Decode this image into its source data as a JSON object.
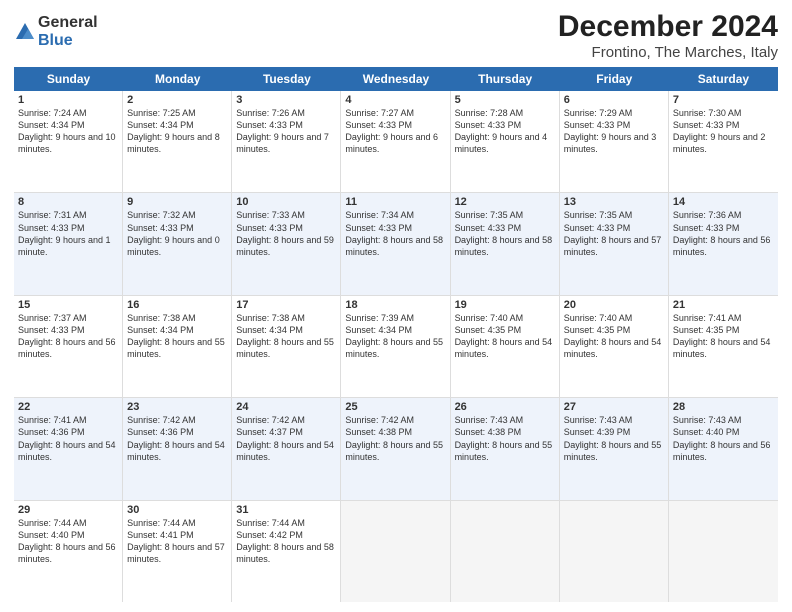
{
  "header": {
    "logo_general": "General",
    "logo_blue": "Blue",
    "title": "December 2024",
    "subtitle": "Frontino, The Marches, Italy"
  },
  "weekdays": [
    "Sunday",
    "Monday",
    "Tuesday",
    "Wednesday",
    "Thursday",
    "Friday",
    "Saturday"
  ],
  "weeks": [
    [
      {
        "day": "1",
        "sunrise": "Sunrise: 7:24 AM",
        "sunset": "Sunset: 4:34 PM",
        "daylight": "Daylight: 9 hours and 10 minutes."
      },
      {
        "day": "2",
        "sunrise": "Sunrise: 7:25 AM",
        "sunset": "Sunset: 4:34 PM",
        "daylight": "Daylight: 9 hours and 8 minutes."
      },
      {
        "day": "3",
        "sunrise": "Sunrise: 7:26 AM",
        "sunset": "Sunset: 4:33 PM",
        "daylight": "Daylight: 9 hours and 7 minutes."
      },
      {
        "day": "4",
        "sunrise": "Sunrise: 7:27 AM",
        "sunset": "Sunset: 4:33 PM",
        "daylight": "Daylight: 9 hours and 6 minutes."
      },
      {
        "day": "5",
        "sunrise": "Sunrise: 7:28 AM",
        "sunset": "Sunset: 4:33 PM",
        "daylight": "Daylight: 9 hours and 4 minutes."
      },
      {
        "day": "6",
        "sunrise": "Sunrise: 7:29 AM",
        "sunset": "Sunset: 4:33 PM",
        "daylight": "Daylight: 9 hours and 3 minutes."
      },
      {
        "day": "7",
        "sunrise": "Sunrise: 7:30 AM",
        "sunset": "Sunset: 4:33 PM",
        "daylight": "Daylight: 9 hours and 2 minutes."
      }
    ],
    [
      {
        "day": "8",
        "sunrise": "Sunrise: 7:31 AM",
        "sunset": "Sunset: 4:33 PM",
        "daylight": "Daylight: 9 hours and 1 minute."
      },
      {
        "day": "9",
        "sunrise": "Sunrise: 7:32 AM",
        "sunset": "Sunset: 4:33 PM",
        "daylight": "Daylight: 9 hours and 0 minutes."
      },
      {
        "day": "10",
        "sunrise": "Sunrise: 7:33 AM",
        "sunset": "Sunset: 4:33 PM",
        "daylight": "Daylight: 8 hours and 59 minutes."
      },
      {
        "day": "11",
        "sunrise": "Sunrise: 7:34 AM",
        "sunset": "Sunset: 4:33 PM",
        "daylight": "Daylight: 8 hours and 58 minutes."
      },
      {
        "day": "12",
        "sunrise": "Sunrise: 7:35 AM",
        "sunset": "Sunset: 4:33 PM",
        "daylight": "Daylight: 8 hours and 58 minutes."
      },
      {
        "day": "13",
        "sunrise": "Sunrise: 7:35 AM",
        "sunset": "Sunset: 4:33 PM",
        "daylight": "Daylight: 8 hours and 57 minutes."
      },
      {
        "day": "14",
        "sunrise": "Sunrise: 7:36 AM",
        "sunset": "Sunset: 4:33 PM",
        "daylight": "Daylight: 8 hours and 56 minutes."
      }
    ],
    [
      {
        "day": "15",
        "sunrise": "Sunrise: 7:37 AM",
        "sunset": "Sunset: 4:33 PM",
        "daylight": "Daylight: 8 hours and 56 minutes."
      },
      {
        "day": "16",
        "sunrise": "Sunrise: 7:38 AM",
        "sunset": "Sunset: 4:34 PM",
        "daylight": "Daylight: 8 hours and 55 minutes."
      },
      {
        "day": "17",
        "sunrise": "Sunrise: 7:38 AM",
        "sunset": "Sunset: 4:34 PM",
        "daylight": "Daylight: 8 hours and 55 minutes."
      },
      {
        "day": "18",
        "sunrise": "Sunrise: 7:39 AM",
        "sunset": "Sunset: 4:34 PM",
        "daylight": "Daylight: 8 hours and 55 minutes."
      },
      {
        "day": "19",
        "sunrise": "Sunrise: 7:40 AM",
        "sunset": "Sunset: 4:35 PM",
        "daylight": "Daylight: 8 hours and 54 minutes."
      },
      {
        "day": "20",
        "sunrise": "Sunrise: 7:40 AM",
        "sunset": "Sunset: 4:35 PM",
        "daylight": "Daylight: 8 hours and 54 minutes."
      },
      {
        "day": "21",
        "sunrise": "Sunrise: 7:41 AM",
        "sunset": "Sunset: 4:35 PM",
        "daylight": "Daylight: 8 hours and 54 minutes."
      }
    ],
    [
      {
        "day": "22",
        "sunrise": "Sunrise: 7:41 AM",
        "sunset": "Sunset: 4:36 PM",
        "daylight": "Daylight: 8 hours and 54 minutes."
      },
      {
        "day": "23",
        "sunrise": "Sunrise: 7:42 AM",
        "sunset": "Sunset: 4:36 PM",
        "daylight": "Daylight: 8 hours and 54 minutes."
      },
      {
        "day": "24",
        "sunrise": "Sunrise: 7:42 AM",
        "sunset": "Sunset: 4:37 PM",
        "daylight": "Daylight: 8 hours and 54 minutes."
      },
      {
        "day": "25",
        "sunrise": "Sunrise: 7:42 AM",
        "sunset": "Sunset: 4:38 PM",
        "daylight": "Daylight: 8 hours and 55 minutes."
      },
      {
        "day": "26",
        "sunrise": "Sunrise: 7:43 AM",
        "sunset": "Sunset: 4:38 PM",
        "daylight": "Daylight: 8 hours and 55 minutes."
      },
      {
        "day": "27",
        "sunrise": "Sunrise: 7:43 AM",
        "sunset": "Sunset: 4:39 PM",
        "daylight": "Daylight: 8 hours and 55 minutes."
      },
      {
        "day": "28",
        "sunrise": "Sunrise: 7:43 AM",
        "sunset": "Sunset: 4:40 PM",
        "daylight": "Daylight: 8 hours and 56 minutes."
      }
    ],
    [
      {
        "day": "29",
        "sunrise": "Sunrise: 7:44 AM",
        "sunset": "Sunset: 4:40 PM",
        "daylight": "Daylight: 8 hours and 56 minutes."
      },
      {
        "day": "30",
        "sunrise": "Sunrise: 7:44 AM",
        "sunset": "Sunset: 4:41 PM",
        "daylight": "Daylight: 8 hours and 57 minutes."
      },
      {
        "day": "31",
        "sunrise": "Sunrise: 7:44 AM",
        "sunset": "Sunset: 4:42 PM",
        "daylight": "Daylight: 8 hours and 58 minutes."
      },
      null,
      null,
      null,
      null
    ]
  ]
}
